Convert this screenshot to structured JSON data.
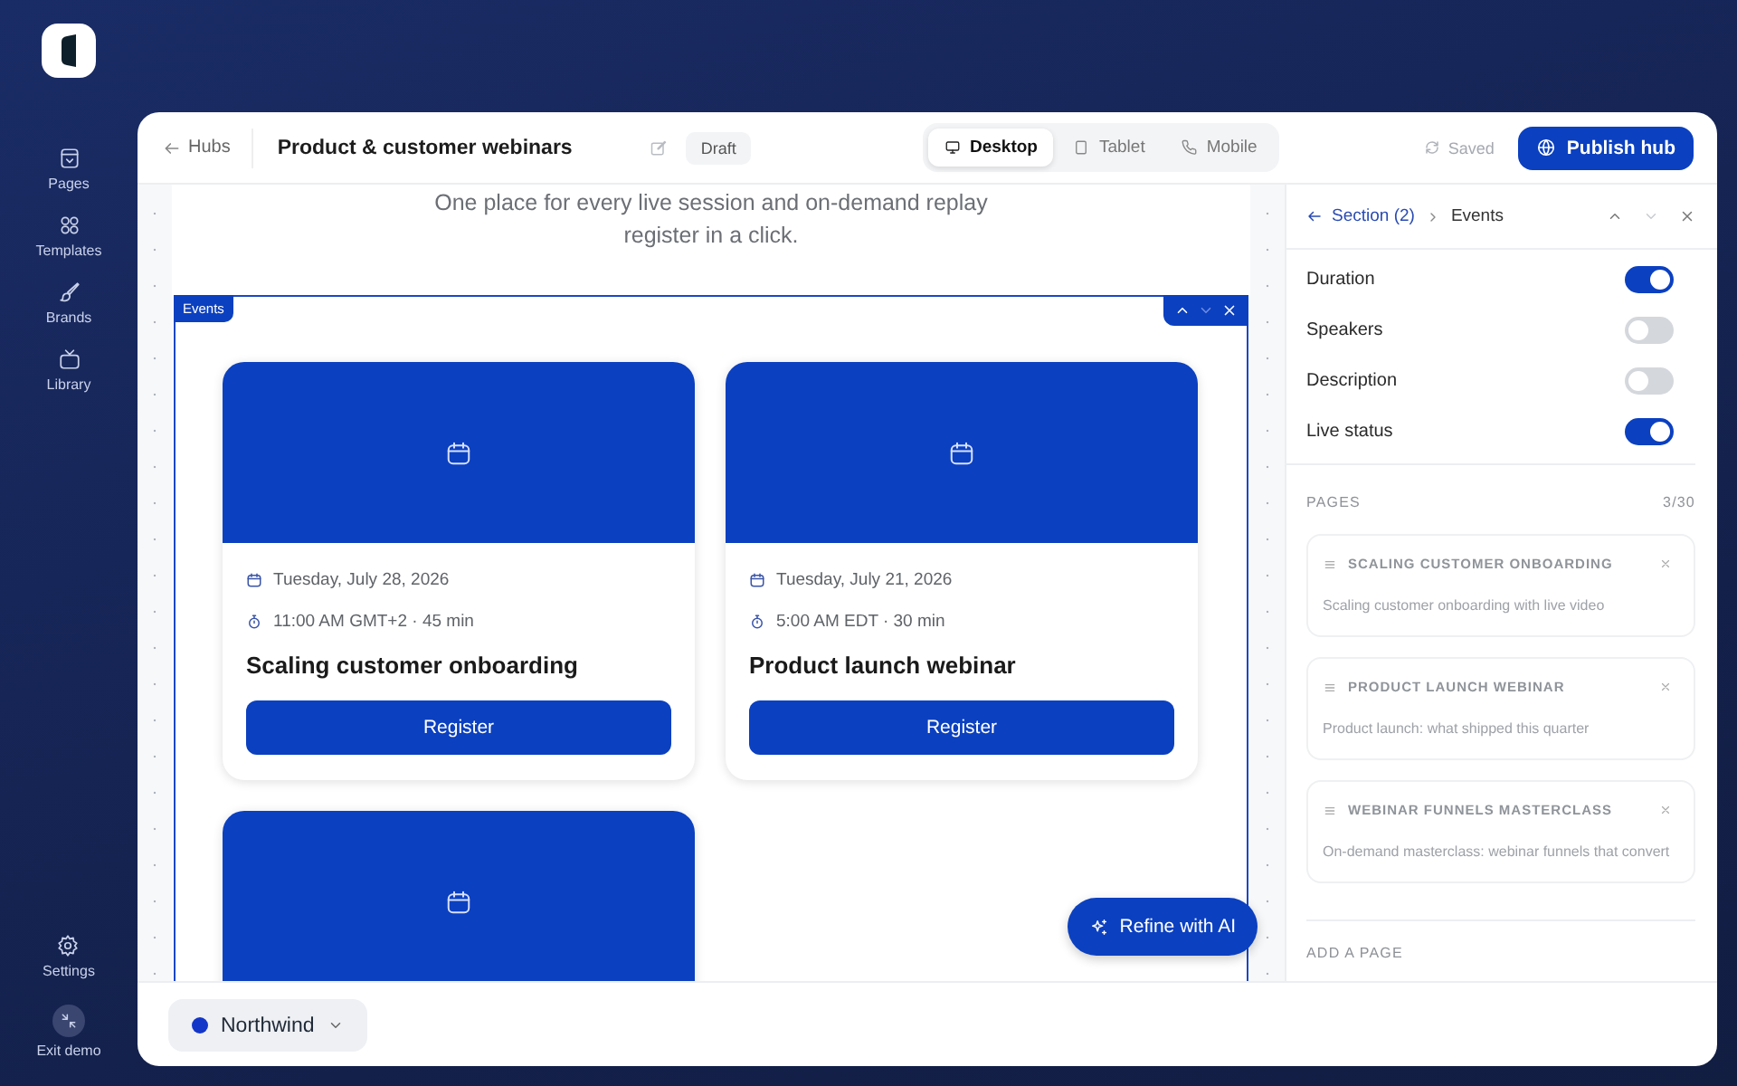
{
  "sidebar": {
    "items": [
      {
        "label": "Pages",
        "kind": "pages"
      },
      {
        "label": "Templates",
        "kind": "templates"
      },
      {
        "label": "Brands",
        "kind": "brands"
      },
      {
        "label": "Library",
        "kind": "library"
      }
    ],
    "footer_items": [
      {
        "label": "Settings",
        "kind": "settings"
      },
      {
        "label": "Exit demo",
        "kind": "exit"
      }
    ]
  },
  "header": {
    "back": "Hubs",
    "title": "Product & customer webinars",
    "status": "Draft",
    "devices": [
      {
        "label": "Desktop",
        "kind": "desktop",
        "selected": true
      },
      {
        "label": "Tablet",
        "kind": "tablet",
        "selected": false
      },
      {
        "label": "Mobile",
        "kind": "mobile",
        "selected": false
      }
    ],
    "save_state": "Saved",
    "publish": "Publish hub"
  },
  "canvas": {
    "intro": [
      "One place for every live session and on-demand replay",
      "register in a click."
    ],
    "section": {
      "label": "Events",
      "events": [
        {
          "kind": "detail",
          "date": "Tuesday, July 28, 2026",
          "time": "11:00 AM GMT+2 · 45 min",
          "title": "Scaling customer onboarding",
          "button": "Register"
        },
        {
          "kind": "detail",
          "date": "Tuesday, July 21, 2026",
          "time": "5:00 AM EDT · 30 min",
          "title": "Product launch webinar",
          "button": "Register"
        },
        {
          "kind": "image_only"
        }
      ]
    },
    "ai_button": "Refine with AI"
  },
  "inspector": {
    "breadcrumb": {
      "back": "Section (2)",
      "current": "Events"
    },
    "toggles": [
      {
        "label": "Duration",
        "on": true
      },
      {
        "label": "Speakers",
        "on": false
      },
      {
        "label": "Description",
        "on": false
      },
      {
        "label": "Live status",
        "on": true
      }
    ],
    "pages": {
      "heading": "PAGES",
      "count": "3/30",
      "items": [
        {
          "title": "SCALING CUSTOMER ONBOARDING",
          "description": "Scaling customer onboarding with live video"
        },
        {
          "title": "PRODUCT LAUNCH WEBINAR",
          "description": "Product launch: what shipped this quarter"
        },
        {
          "title": "WEBINAR FUNNELS MASTERCLASS",
          "description": "On-demand masterclass: webinar funnels that convert"
        }
      ]
    },
    "add_heading": "ADD A PAGE"
  },
  "brand_switcher": {
    "label": "Northwind"
  }
}
